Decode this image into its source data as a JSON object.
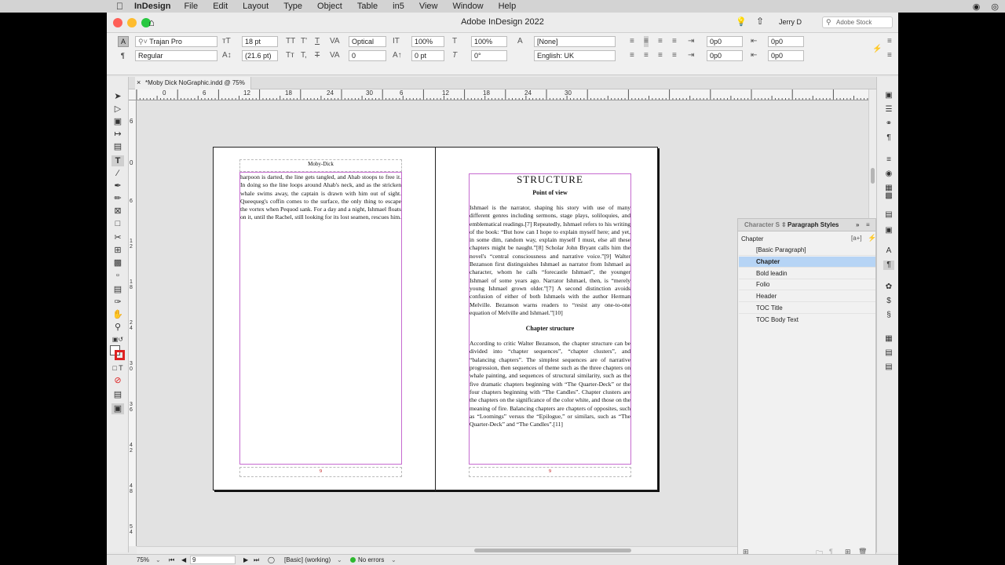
{
  "menubar": {
    "app_name": "InDesign",
    "items": [
      "File",
      "Edit",
      "Layout",
      "Type",
      "Object",
      "Table",
      "in5",
      "View",
      "Window",
      "Help"
    ]
  },
  "window": {
    "title": "Adobe InDesign 2022",
    "user": "Jerry D",
    "search_placeholder": "Adobe Stock"
  },
  "control": {
    "font_family": "Trajan Pro",
    "font_style": "Regular",
    "font_size": "18 pt",
    "leading": "(21.6 pt)",
    "kerning": "Optical",
    "tracking": "0",
    "vscale": "100%",
    "hscale": "100%",
    "baseline": "0 pt",
    "skew": "0°",
    "char_style": "[None]",
    "language": "English: UK",
    "indent_left": "0p0",
    "indent_right": "0p0",
    "first_indent": "0p0",
    "last_indent": "0p0"
  },
  "document": {
    "tab_label": "*Moby Dick NoGraphic.indd @ 75%"
  },
  "ruler": {
    "h_labels": [
      "0",
      "6",
      "12",
      "18",
      "24",
      "30",
      "6",
      "12",
      "18",
      "24",
      "30"
    ],
    "v_labels": [
      "6",
      "0",
      "6",
      "1 2",
      "1 8",
      "2 4",
      "3 0",
      "3 6",
      "4 2",
      "4 8",
      "5 4"
    ]
  },
  "left_page": {
    "running_head": "Moby-Dick",
    "body": "harpoon is darted, the line gets tangled, and Ahab stoops to free it. In doing so the line loops around Ahab's neck, and as the stricken whale swims away, the captain is drawn with him out of sight. Queequeg's coffin comes to the surface, the only thing to escape the vortex when Pequod sank. For a day and a night, Ishmael floats on it, until the Rachel, still looking for its lost seamen, rescues him.",
    "folio": "9"
  },
  "right_page": {
    "title": "STRUCTURE",
    "h1": "Point of view",
    "p1": "Ishmael is the narrator, shaping his story with use of many different genres including sermons, stage plays, soliloquies, and emblematical readings.[7] Repeatedly, Ishmael refers to his writing of the book: “But how can I hope to explain myself here; and yet, in some dim, random way, explain myself I must, else all these chapters might be naught.”[8] Scholar John Bryant calls him the novel's “central consciousness and narrative voice.”[9] Walter Bezanson first distinguishes Ishmael as narrator from Ishmael as character, whom he calls “forecastle Ishmael”, the younger Ishmael of some years ago. Narrator Ishmael, then, is “merely young Ishmael grown older.”[7] A second distinction avoids confusion of either of both Ishmaels with the author Herman Melville. Bezanson warns readers to “resist any one-to-one equation of Melville and Ishmael.”[10]",
    "h2": "Chapter structure",
    "p2": "According to critic Walter Bezanson, the chapter structure can be divided into “chapter sequences”, “chapter clusters”, and “balancing chapters”. The simplest sequences are of narrative progression, then sequences of theme such as the three chapters on whale painting, and sequences of structural similarity, such as the five dramatic chapters beginning with “The Quarter-Deck” or the four chapters beginning with “The Candles”. Chapter clusters are the chapters on the significance of the color white, and those on the meaning of fire. Balancing chapters are chapters of opposites, such as “Loomings” versus the “Epilogue,” or similars, such as “The Quarter-Deck” and “The Candles”.[11]",
    "folio": "9"
  },
  "paragraph_styles_panel": {
    "tab_character": "Character St",
    "tab_paragraph": "Paragraph Styles",
    "current": "Chapter",
    "items": [
      "[Basic Paragraph]",
      "Chapter",
      "Bold leadin",
      "Folio",
      "Header",
      "TOC Title",
      "TOC Body Text"
    ],
    "selected_index": 1
  },
  "status": {
    "zoom": "75%",
    "page": "9",
    "master": "[Basic] (working)",
    "preflight": "No errors",
    "preflight_color": "#2eb82e"
  }
}
